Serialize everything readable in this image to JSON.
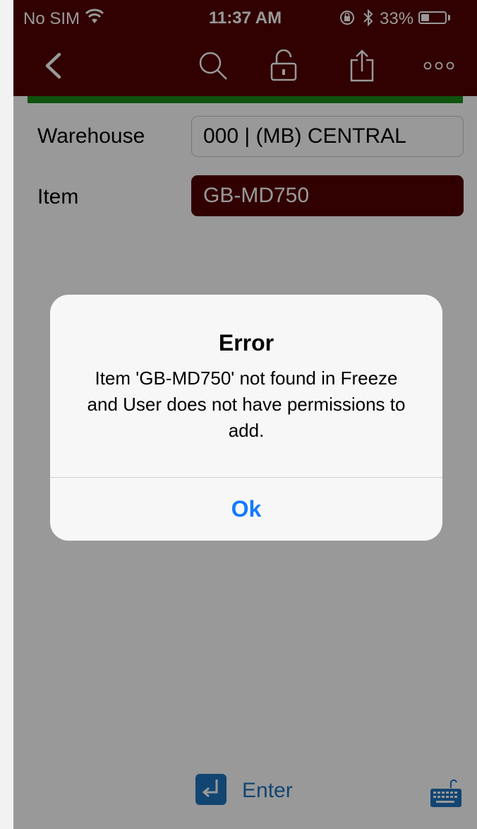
{
  "status_bar": {
    "carrier": "No SIM",
    "time": "11:37 AM",
    "battery_percent": "33%",
    "battery_level": 0.33,
    "wifi_icon": "wifi-icon",
    "orientation_lock_icon": "orientation-lock-icon",
    "bluetooth_icon": "bluetooth-icon"
  },
  "nav_bar": {
    "icons": [
      "back-chevron-icon",
      "search-icon",
      "unlock-icon",
      "share-icon",
      "more-icon"
    ],
    "background": "#520000"
  },
  "form": {
    "warehouse": {
      "label": "Warehouse",
      "value": "000 | (MB) CENTRAL"
    },
    "item": {
      "label": "Item",
      "value": "GB-MD750"
    },
    "accent_green": "#1a8a1a"
  },
  "bottom_bar": {
    "enter_label": "Enter",
    "accent": "#1e73be"
  },
  "alert": {
    "title": "Error",
    "message": "Item 'GB-MD750' not found in Freeze and User does not have permissions to add.",
    "ok_label": "Ok",
    "ok_color": "#1479ff"
  }
}
